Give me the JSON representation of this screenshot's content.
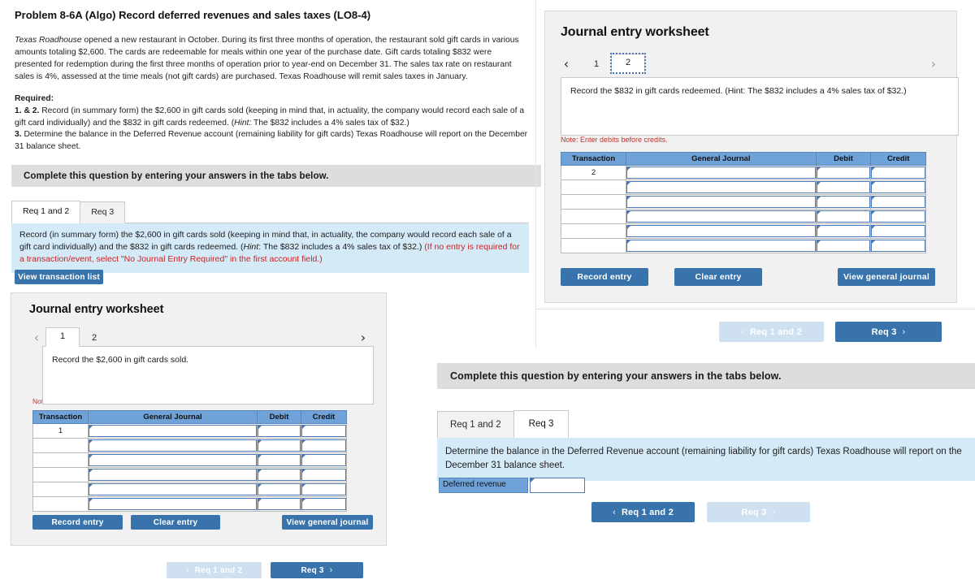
{
  "problem": {
    "title": "Problem 8-6A (Algo) Record deferred revenues and sales taxes (LO8-4)",
    "para_company": "Texas Roadhouse",
    "para_rest": " opened a new restaurant in October. During its first three months of operation, the restaurant sold gift cards in various amounts totaling $2,600. The cards are redeemable for meals within one year of the purchase date. Gift cards totaling $832 were presented for redemption during the first three months of operation prior to year-end on December 31. The sales tax rate on restaurant sales is 4%, assessed at the time meals (not gift cards) are purchased. Texas Roadhouse will remit sales taxes in January.",
    "required_label": "Required:",
    "req12_num": "1. & 2.",
    "req12_text": " Record (in summary form) the $2,600 in gift cards sold (keeping in mind that, in actuality, the company would record each sale of a gift card individually) and the $832 in gift cards redeemed. (",
    "req12_hint": "Hint:",
    "req12_tail": " The $832 includes a 4% sales tax of $32.)",
    "req3_num": "3.",
    "req3_text": " Determine the balance in the Deferred Revenue account (remaining liability for gift cards) Texas Roadhouse will report on the December 31 balance sheet."
  },
  "left": {
    "banner": "Complete this question by entering your answers in the tabs below.",
    "tabs": [
      {
        "label": "Req 1 and 2",
        "active": true
      },
      {
        "label": "Req 3",
        "active": false
      }
    ],
    "instruction_main": "Record (in summary form) the $2,600 in gift cards sold (keeping in mind that, in actuality, the company would record each sale of a gift card individually) and the $832 in gift cards redeemed. (",
    "instruction_hint": "Hint",
    "instruction_mid": ": The $832 includes a 4% sales tax of $32.) ",
    "instruction_red": "(If no entry is required for a transaction/event, select \"No Journal Entry Required\" in the first account field.)",
    "view_transaction_list": "View transaction list",
    "worksheet": {
      "title": "Journal entry worksheet",
      "prev_arrow": "‹",
      "next_arrow": "›",
      "pages": [
        {
          "label": "1",
          "active": true
        },
        {
          "label": "2",
          "active": false
        }
      ],
      "description": "Record the $2,600 in gift cards sold.",
      "note": "Note: Enter debits before credits.",
      "columns": [
        "Transaction",
        "General Journal",
        "Debit",
        "Credit"
      ],
      "rows": [
        {
          "transaction": "1"
        },
        {
          "transaction": ""
        },
        {
          "transaction": ""
        },
        {
          "transaction": ""
        },
        {
          "transaction": ""
        },
        {
          "transaction": ""
        }
      ],
      "buttons": {
        "record": "Record entry",
        "clear": "Clear entry",
        "view": "View general journal"
      }
    },
    "nav": {
      "prev_label": "Req 1 and 2",
      "next_label": "Req 3",
      "prev_chevron": "‹",
      "next_chevron": "›"
    }
  },
  "right_top": {
    "worksheet": {
      "title": "Journal entry worksheet",
      "prev_arrow": "‹",
      "next_arrow": "›",
      "pages": [
        {
          "label": "1",
          "active": false
        },
        {
          "label": "2",
          "active": true
        }
      ],
      "description": "Record the $832 in gift cards redeemed. (Hint: The $832 includes a 4% sales tax of $32.)",
      "note": "Note: Enter debits before credits.",
      "columns": [
        "Transaction",
        "General Journal",
        "Debit",
        "Credit"
      ],
      "rows": [
        {
          "transaction": "2"
        },
        {
          "transaction": ""
        },
        {
          "transaction": ""
        },
        {
          "transaction": ""
        },
        {
          "transaction": ""
        },
        {
          "transaction": ""
        }
      ],
      "buttons": {
        "record": "Record entry",
        "clear": "Clear entry",
        "view": "View general journal"
      }
    },
    "nav": {
      "prev_label": "Req 1 and 2",
      "next_label": "Req 3",
      "prev_chevron": "‹",
      "next_chevron": "›"
    }
  },
  "right_bottom": {
    "banner": "Complete this question by entering your answers in the tabs below.",
    "tabs": [
      {
        "label": "Req 1 and 2",
        "active": false
      },
      {
        "label": "Req 3",
        "active": true
      }
    ],
    "instruction": "Determine the balance in the Deferred Revenue account (remaining liability for gift cards) Texas Roadhouse will report on the December 31 balance sheet.",
    "answer_label": "Deferred revenue",
    "answer_value": "",
    "nav": {
      "prev_label": "Req 1 and 2",
      "next_label": "Req 3",
      "prev_chevron": "‹",
      "next_chevron": "›"
    }
  },
  "colors": {
    "accent_blue": "#3874ab",
    "disabled_blue": "#cfe0f0",
    "table_header_blue": "#6fa2d8",
    "instruction_blue": "#d5eaf7",
    "banner_gray": "#dddddd",
    "panel_gray": "#f1f1f1",
    "note_red": "#c9302c"
  }
}
